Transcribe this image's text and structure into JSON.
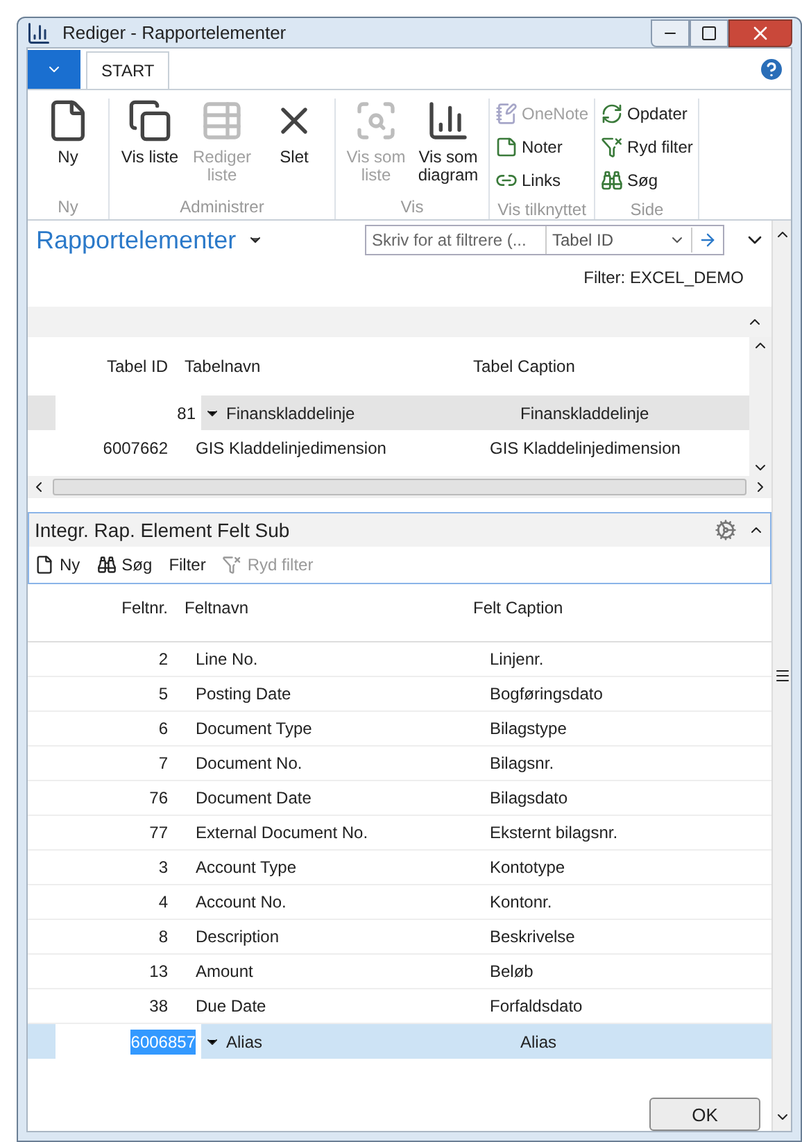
{
  "window": {
    "title": "Rediger - Rapportelementer"
  },
  "ribbon": {
    "tabs": [
      {
        "label": "START",
        "selected": true
      }
    ],
    "groups": [
      {
        "label": "Ny",
        "buttons": [
          {
            "kind": "large",
            "label": "Ny",
            "disabled": false
          }
        ]
      },
      {
        "label": "Administrer",
        "buttons": [
          {
            "kind": "large",
            "label": "Vis liste",
            "disabled": false
          },
          {
            "kind": "large",
            "label": "Rediger liste",
            "disabled": true
          },
          {
            "kind": "large",
            "label": "Slet",
            "disabled": false
          }
        ]
      },
      {
        "label": "Vis",
        "buttons": [
          {
            "kind": "large",
            "label": "Vis som liste",
            "disabled": true
          },
          {
            "kind": "large",
            "label": "Vis som diagram",
            "disabled": false
          }
        ]
      },
      {
        "label": "Vis tilknyttet",
        "buttons": [
          {
            "kind": "small",
            "label": "OneNote",
            "disabled": true
          },
          {
            "kind": "small",
            "label": "Noter",
            "disabled": false
          },
          {
            "kind": "small",
            "label": "Links",
            "disabled": false
          }
        ]
      },
      {
        "label": "Side",
        "buttons": [
          {
            "kind": "small",
            "label": "Opdater",
            "disabled": false
          },
          {
            "kind": "small",
            "label": "Ryd filter",
            "disabled": false
          },
          {
            "kind": "small",
            "label": "Søg",
            "disabled": false
          }
        ]
      }
    ]
  },
  "page": {
    "title": "Rapportelementer",
    "filter_placeholder": "Skriv for at filtrere (...",
    "filter_field": "Tabel ID",
    "filter_text": "Filter: EXCEL_DEMO"
  },
  "table": {
    "columns": [
      "Tabel ID",
      "Tabelnavn",
      "Tabel Caption"
    ],
    "rows": [
      {
        "cells": [
          "81",
          "Finanskladdelinje",
          "Finanskladdelinje"
        ],
        "selected": true
      },
      {
        "cells": [
          "6007662",
          "GIS Kladdelinjedimension",
          "GIS Kladdelinjedimension"
        ],
        "selected": false
      }
    ]
  },
  "subpage": {
    "title": "Integr. Rap. Element Felt Sub",
    "actions": [
      {
        "label": "Ny",
        "disabled": false
      },
      {
        "label": "Søg",
        "disabled": false
      },
      {
        "label": "Filter",
        "disabled": false
      },
      {
        "label": "Ryd filter",
        "disabled": true
      }
    ],
    "columns": [
      "Feltnr.",
      "Feltnavn",
      "Felt Caption"
    ],
    "rows": [
      {
        "cells": [
          "2",
          "Line No.",
          "Linjenr."
        ],
        "selected": false
      },
      {
        "cells": [
          "5",
          "Posting Date",
          "Bogføringsdato"
        ],
        "selected": false
      },
      {
        "cells": [
          "6",
          "Document Type",
          "Bilagstype"
        ],
        "selected": false
      },
      {
        "cells": [
          "7",
          "Document No.",
          "Bilagsnr."
        ],
        "selected": false
      },
      {
        "cells": [
          "76",
          "Document Date",
          "Bilagsdato"
        ],
        "selected": false
      },
      {
        "cells": [
          "77",
          "External Document No.",
          "Eksternt bilagsnr."
        ],
        "selected": false
      },
      {
        "cells": [
          "3",
          "Account Type",
          "Kontotype"
        ],
        "selected": false
      },
      {
        "cells": [
          "4",
          "Account No.",
          "Kontonr."
        ],
        "selected": false
      },
      {
        "cells": [
          "8",
          "Description",
          "Beskrivelse"
        ],
        "selected": false
      },
      {
        "cells": [
          "13",
          "Amount",
          "Beløb"
        ],
        "selected": false
      },
      {
        "cells": [
          "38",
          "Due Date",
          "Forfaldsdato"
        ],
        "selected": false
      },
      {
        "cells": [
          "6006857",
          "Alias",
          "Alias"
        ],
        "selected": true
      }
    ]
  },
  "buttons": [
    "OK"
  ]
}
